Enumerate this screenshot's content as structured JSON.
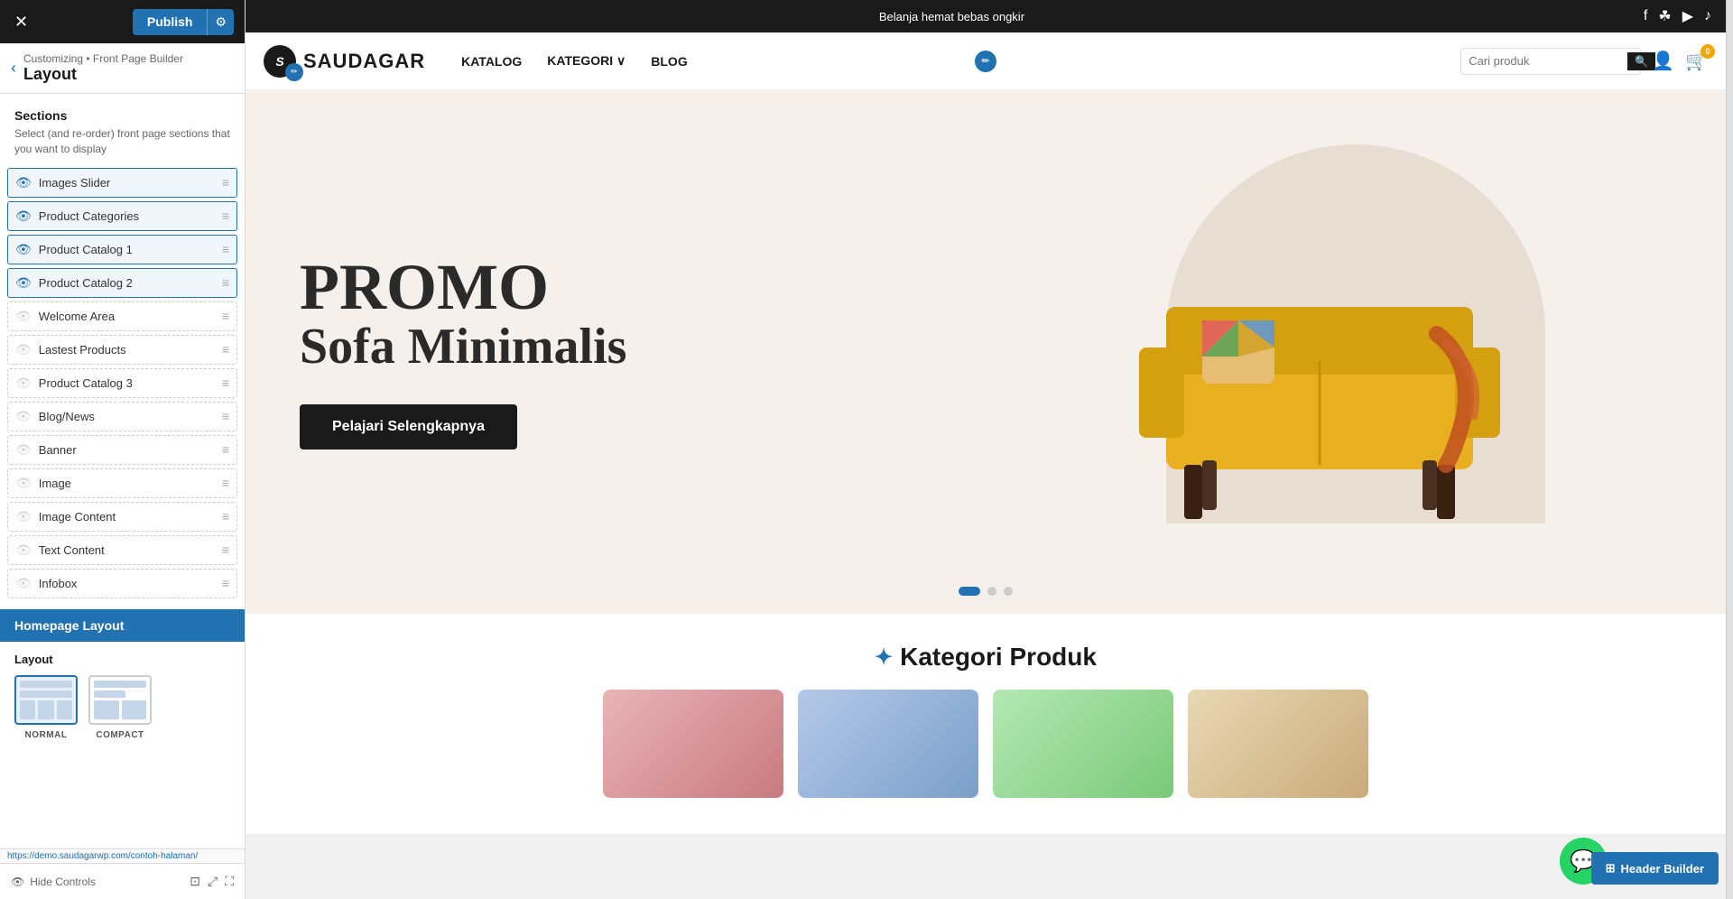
{
  "panel": {
    "publish_label": "Publish",
    "gear_label": "⚙",
    "close_label": "✕",
    "breadcrumb": "Customizing • Front Page Builder",
    "page_title": "Layout",
    "back_arrow": "‹",
    "sections_title": "Sections",
    "sections_desc": "Select (and re-order) front page sections that you want to display",
    "sections": [
      {
        "name": "Images Slider",
        "active": true,
        "visible": true
      },
      {
        "name": "Product Categories",
        "active": true,
        "visible": true
      },
      {
        "name": "Product Catalog 1",
        "active": true,
        "visible": true
      },
      {
        "name": "Product Catalog 2",
        "active": true,
        "visible": true
      },
      {
        "name": "Welcome Area",
        "active": false,
        "visible": false
      },
      {
        "name": "Lastest Products",
        "active": false,
        "visible": false
      },
      {
        "name": "Product Catalog 3",
        "active": false,
        "visible": false
      },
      {
        "name": "Blog/News",
        "active": false,
        "visible": false
      },
      {
        "name": "Banner",
        "active": false,
        "visible": false
      },
      {
        "name": "Image",
        "active": false,
        "visible": false
      },
      {
        "name": "Image Content",
        "active": false,
        "visible": false
      },
      {
        "name": "Text Content",
        "active": false,
        "visible": false
      },
      {
        "name": "Infobox",
        "active": false,
        "visible": false
      }
    ],
    "homepage_layout_label": "Homepage Layout",
    "layout_label": "Layout",
    "layout_options": [
      {
        "id": "normal",
        "label": "NORMAL",
        "selected": true
      },
      {
        "id": "compact",
        "label": "COMPACT",
        "selected": false
      }
    ],
    "hide_controls_label": "Hide Controls",
    "url_label": "https://demo.saudagarwp.com/contoh-halaman/"
  },
  "site": {
    "topbar_text": "Belanja hemat bebas ongkir",
    "logo_text": "SAUDAGAR",
    "nav_links": [
      {
        "label": "KATALOG"
      },
      {
        "label": "KATEGORI",
        "has_dropdown": true
      },
      {
        "label": "BLOG"
      }
    ],
    "search_placeholder": "Cari produk",
    "cart_count": "0",
    "hero": {
      "promo_text": "PROMO",
      "subtitle_text": "Sofa Minimalis",
      "button_label": "Pelajari Selengkapnya"
    },
    "categories_heading": "Kategori Produk",
    "header_builder_label": "Header Builder"
  }
}
